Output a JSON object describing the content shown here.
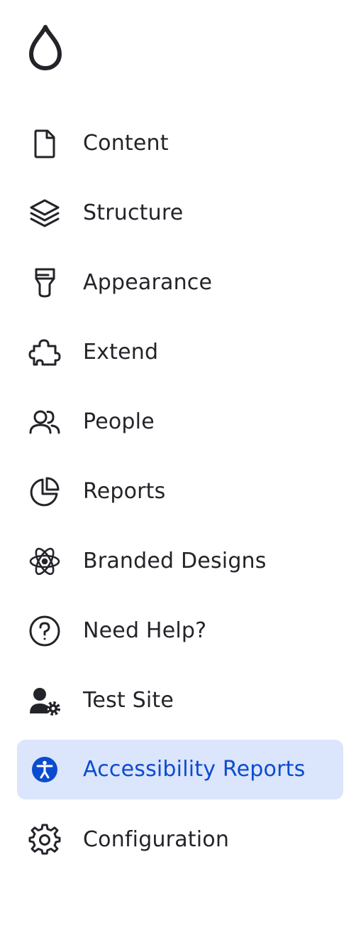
{
  "brand": {
    "logo_icon": "drop-icon"
  },
  "nav": {
    "items": [
      {
        "label": "Content",
        "icon": "file-icon"
      },
      {
        "label": "Structure",
        "icon": "layers-icon"
      },
      {
        "label": "Appearance",
        "icon": "paintbrush-icon"
      },
      {
        "label": "Extend",
        "icon": "puzzle-icon"
      },
      {
        "label": "People",
        "icon": "users-icon"
      },
      {
        "label": "Reports",
        "icon": "pie-chart-icon"
      },
      {
        "label": "Branded Designs",
        "icon": "atom-icon"
      },
      {
        "label": "Need Help?",
        "icon": "question-circle-icon"
      },
      {
        "label": "Test Site",
        "icon": "user-gear-icon"
      },
      {
        "label": "Accessibility Reports",
        "icon": "accessibility-icon",
        "active": true
      },
      {
        "label": "Configuration",
        "icon": "gear-icon"
      }
    ]
  },
  "colors": {
    "text": "#232429",
    "active_text": "#0b4bcf",
    "active_background": "#dbe5fb"
  }
}
